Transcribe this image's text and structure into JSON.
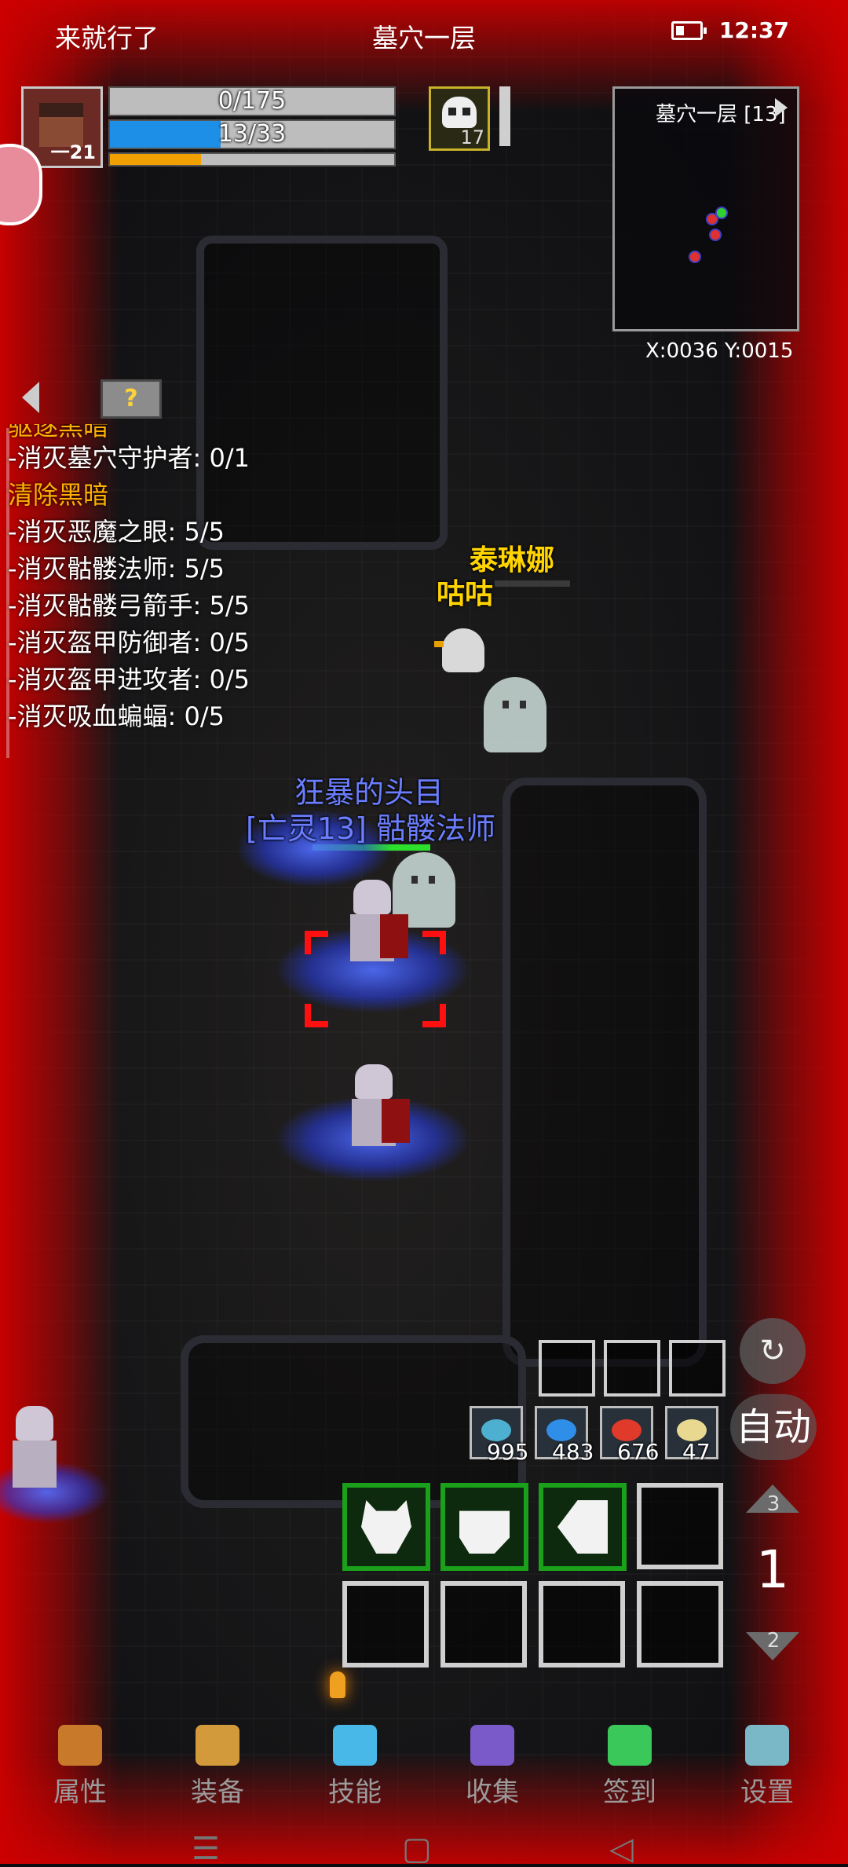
{
  "status_bar": {
    "carrier": "来就行了",
    "title": "墓穴一层",
    "time": "12:37"
  },
  "player": {
    "level": "一21",
    "hp_text": "0/175",
    "hp_fraction": 0.0,
    "mp_text": "13/33",
    "mp_fraction": 0.39,
    "xp_fraction": 0.32
  },
  "pet": {
    "count": "17",
    "icon": "skull-icon"
  },
  "minimap": {
    "title": "墓穴一层 [13]"
  },
  "coords": "X:0036  Y:0015",
  "help_button": "?",
  "quests": {
    "cut_off_line": "驱逐黑暗",
    "lines": [
      {
        "text": "-消灭墓穴守护者: 0/1",
        "type": "item"
      },
      {
        "text": "清除黑暗",
        "type": "head"
      },
      {
        "text": "-消灭恶魔之眼: 5/5",
        "type": "item"
      },
      {
        "text": "-消灭骷髅法师: 5/5",
        "type": "item"
      },
      {
        "text": "-消灭骷髅弓箭手: 5/5",
        "type": "item"
      },
      {
        "text": "-消灭盔甲防御者: 0/5",
        "type": "item"
      },
      {
        "text": "-消灭盔甲进攻者: 0/5",
        "type": "item"
      },
      {
        "text": "-消灭吸血蝙蝠: 0/5",
        "type": "item"
      }
    ]
  },
  "npcs": {
    "companion_name": "泰琳娜",
    "duck_name": "咕咕"
  },
  "enemy": {
    "title": "狂暴的头目",
    "name": "[亡灵13] 骷髅法师",
    "hp_fraction": 1.0
  },
  "items": [
    {
      "icon": "fish-icon",
      "count": "995",
      "color": "#4db0d0"
    },
    {
      "icon": "blue-fish-icon",
      "count": "483",
      "color": "#2f8fe8"
    },
    {
      "icon": "red-fish-icon",
      "count": "676",
      "color": "#e03a2a"
    },
    {
      "icon": "scroll-icon",
      "count": "47",
      "color": "#e8d890"
    }
  ],
  "auto_button": "自动",
  "skill_page": {
    "current": "1",
    "up": "3",
    "down": "2"
  },
  "bottom_nav": [
    {
      "label": "属性",
      "icon": "helmet-icon",
      "color": "#c87a2a"
    },
    {
      "label": "装备",
      "icon": "pot-icon",
      "color": "#d29a3a"
    },
    {
      "label": "技能",
      "icon": "crystal-icon",
      "color": "#48b8e8"
    },
    {
      "label": "收集",
      "icon": "box-icon",
      "color": "#7a5ac8"
    },
    {
      "label": "签到",
      "icon": "gem-icon",
      "color": "#3ac85a"
    },
    {
      "label": "设置",
      "icon": "gear-icon",
      "color": "#7ab8c8"
    }
  ],
  "system_nav": {
    "menu": "☰",
    "home": "▢",
    "back": "◁"
  }
}
